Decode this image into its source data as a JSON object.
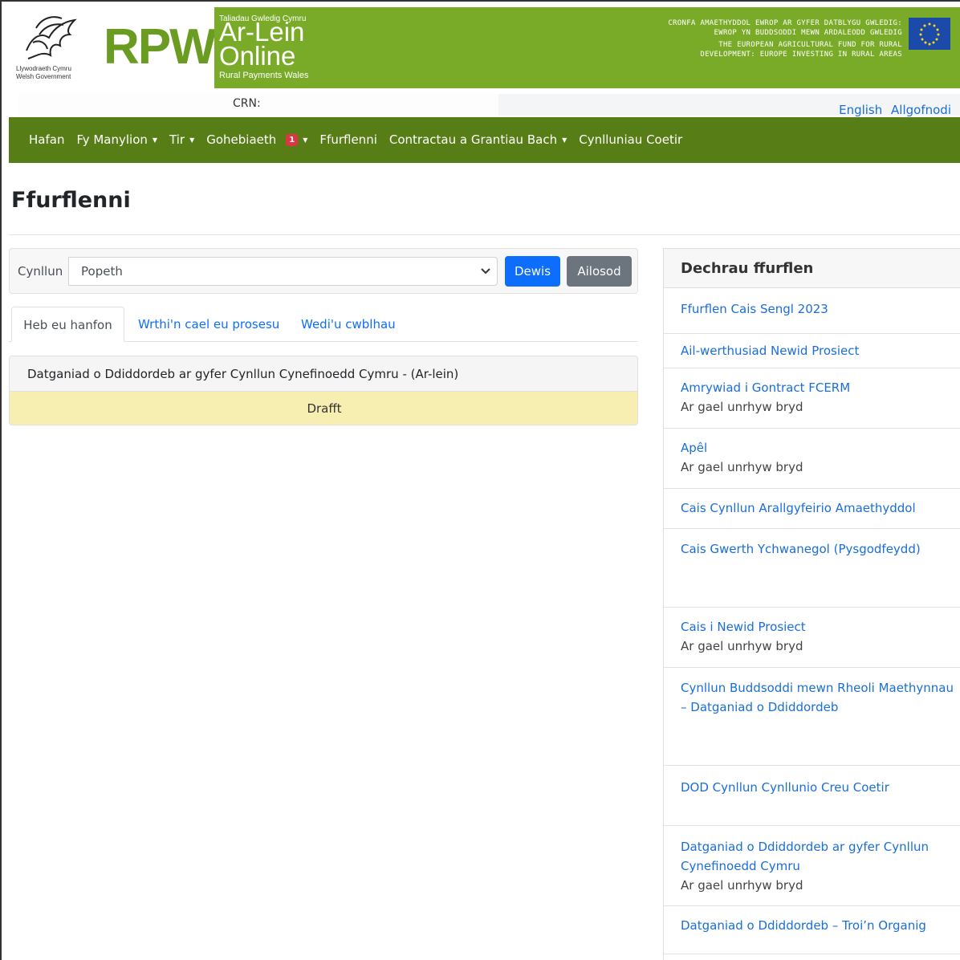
{
  "header": {
    "gov_name_cy": "Llywodraeth Cymru",
    "gov_name_en": "Welsh Government",
    "brand": "RPW",
    "brand_small": "Taliadau Gwledig Cymru",
    "brand_big_1": "Ar-Lein",
    "brand_big_2": "Online",
    "brand_sub": "Rural Payments Wales",
    "eu_cy": "CRONFA AMAETHYDDOL EWROP AR GYFER DATBLYGU GWLEDIG: EWROP YN BUDDSODDI MEWN ARDALEODD GWLEDIG",
    "eu_en": "THE EUROPEAN AGRICULTURAL FUND FOR RURAL DEVELOPMENT: EUROPE INVESTING IN RURAL AREAS"
  },
  "topbar": {
    "crn_label": "CRN:",
    "english": "English",
    "logout": "Allgofnodi"
  },
  "nav": {
    "items": [
      {
        "label": "Hafan"
      },
      {
        "label": "Fy Manylion",
        "dropdown": true
      },
      {
        "label": "Tir",
        "dropdown": true
      },
      {
        "label": "Gohebiaeth",
        "badge": "1",
        "dropdown": true
      },
      {
        "label": "Ffurflenni"
      },
      {
        "label": "Contractau a Grantiau Bach",
        "dropdown": true
      },
      {
        "label": "Cynlluniau Coetir"
      }
    ]
  },
  "page": {
    "title": "Ffurflenni"
  },
  "filter": {
    "label": "Cynllun",
    "selected": "Popeth",
    "select_button": "Dewis",
    "reset_button": "Ailosod"
  },
  "tabs": [
    {
      "label": "Heb eu hanfon",
      "active": true
    },
    {
      "label": "Wrthi'n cael eu prosesu"
    },
    {
      "label": "Wedi'u cwblhau"
    }
  ],
  "results": [
    {
      "title": "Datganiad o Ddiddordeb ar gyfer Cynllun Cynefinoedd Cymru - (Ar-lein)",
      "status": "Drafft"
    }
  ],
  "side": {
    "title": "Dechrau ffurflen",
    "items": [
      {
        "label": "Ffurflen Cais Sengl 2023",
        "sub": ""
      },
      {
        "label": "Ail-werthusiad Newid Prosiect",
        "sub": ""
      },
      {
        "label": "Amrywiad i Gontract FCERM",
        "sub": "Ar gael unrhyw bryd"
      },
      {
        "label": "Apêl",
        "sub": "Ar gael unrhyw bryd"
      },
      {
        "label": "Cais Cynllun Arallgyfeirio Amaethyddol",
        "sub": ""
      },
      {
        "label": "Cais Gwerth Ychwanegol (Pysgodfeydd)",
        "sub": ""
      },
      {
        "label": "Cais i Newid Prosiect",
        "sub": "Ar gael unrhyw bryd"
      },
      {
        "label": "Cynllun Buddsoddi mewn Rheoli Maethynnau – Datganiad o Ddiddordeb",
        "sub": ""
      },
      {
        "label": "DOD Cynllun Cynllunio Creu Coetir",
        "sub": ""
      },
      {
        "label": "Datganiad o Ddiddordeb ar gyfer Cynllun Cynefinoedd Cymru",
        "sub": "Ar gael unrhyw bryd"
      },
      {
        "label": "Datganiad o Ddiddordeb – Troi’n Organig",
        "sub": ""
      }
    ]
  },
  "colors": {
    "header_green": "#7aab28",
    "nav_green": "#577e16",
    "primary": "#0d6efd",
    "secondary": "#6c757d",
    "draft_bg": "#f7efb2",
    "badge_red": "#dc3545"
  }
}
